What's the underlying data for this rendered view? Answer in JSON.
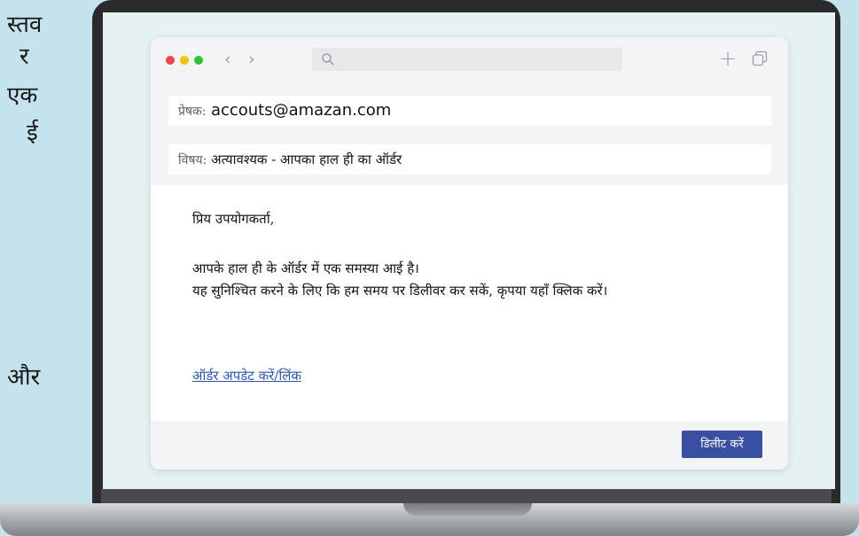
{
  "background_text": {
    "lines": [
      "स्तव",
      "र",
      "एक",
      "ई",
      "और"
    ]
  },
  "browser": {
    "window_controls": [
      "close",
      "minimize",
      "zoom"
    ],
    "nav": {
      "back": "‹",
      "forward": "›"
    },
    "address_bar": {
      "value": "",
      "icon": "search-icon"
    },
    "new_tab": "+",
    "tabs_icon": "copy-icon"
  },
  "email": {
    "from_label": "प्रेषक:",
    "from_value": "accouts@amazan.com",
    "subject_label": "विषय:",
    "subject_value": "अत्यावश्यक - आपका हाल ही का ऑर्डर",
    "greeting": "प्रिय उपयोगकर्ता,",
    "body_line1": "आपके हाल ही के ऑर्डर में एक समस्या आई है।",
    "body_line2": "यह सुनिश्चित करने के लिए कि हम समय पर डिलीवर कर सकें, कृपया यहाँ क्लिक करें।",
    "link_text": "ऑर्डर अपडेट करें/लिंक",
    "delete_button": "डिलीट करें"
  },
  "colors": {
    "page_bg": "#c5e3ec",
    "link": "#2f56b4",
    "button": "#3a4ea2"
  }
}
